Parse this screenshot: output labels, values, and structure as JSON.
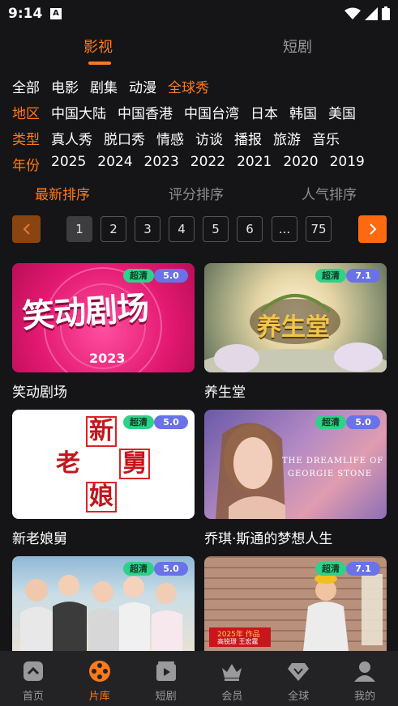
{
  "status": {
    "time": "9:14",
    "notif_glyph": "A"
  },
  "top_tabs": [
    {
      "label": "影视",
      "active": true
    },
    {
      "label": "短剧",
      "active": false
    }
  ],
  "filters": {
    "category": {
      "options": [
        "全部",
        "电影",
        "剧集",
        "动漫",
        "全球秀"
      ],
      "selected": "全球秀"
    },
    "region": {
      "label": "地区",
      "options": [
        "中国大陆",
        "中国香港",
        "中国台湾",
        "日本",
        "韩国",
        "美国"
      ]
    },
    "type": {
      "label": "类型",
      "options": [
        "真人秀",
        "脱口秀",
        "情感",
        "访谈",
        "播报",
        "旅游",
        "音乐"
      ]
    },
    "year": {
      "label": "年份",
      "options": [
        "2025",
        "2024",
        "2023",
        "2022",
        "2021",
        "2020",
        "2019"
      ]
    }
  },
  "sort": [
    {
      "label": "最新排序",
      "active": true
    },
    {
      "label": "评分排序",
      "active": false
    },
    {
      "label": "人气排序",
      "active": false
    }
  ],
  "pager": {
    "pages": [
      "1",
      "2",
      "3",
      "4",
      "5",
      "6",
      "...",
      "75"
    ],
    "current": "1"
  },
  "cards": [
    {
      "title": "笑动剧场",
      "quality": "超清",
      "score": "5.0",
      "art_text": "笑动剧场",
      "art_year": "2023"
    },
    {
      "title": "养生堂",
      "quality": "超清",
      "score": "7.1",
      "art_text": "养生堂"
    },
    {
      "title": "新老娘舅",
      "quality": "超清",
      "score": "5.0",
      "art_chars": [
        "新",
        "老",
        "舅",
        "娘"
      ]
    },
    {
      "title": "乔琪·斯通的梦想人生",
      "quality": "超清",
      "score": "5.0",
      "art_text_1": "THE DREAMLIFE OF",
      "art_text_2": "GEORGIE STONE"
    },
    {
      "title": "",
      "quality": "超清",
      "score": "5.0"
    },
    {
      "title": "",
      "quality": "超清",
      "score": "7.1",
      "art_stamp": "2025年 作品",
      "art_sub": "高锐璟 王宏霆"
    }
  ],
  "bottom_nav": [
    {
      "label": "首页",
      "icon": "home-icon",
      "active": false
    },
    {
      "label": "片库",
      "icon": "film-reel-icon",
      "active": true
    },
    {
      "label": "短剧",
      "icon": "play-clapper-icon",
      "active": false
    },
    {
      "label": "会员",
      "icon": "crown-icon",
      "active": false
    },
    {
      "label": "全球",
      "icon": "diamond-icon",
      "active": false
    },
    {
      "label": "我的",
      "icon": "user-icon",
      "active": false
    }
  ],
  "colors": {
    "accent": "#ff7a1a",
    "background": "#151517",
    "hd_badge": "#2fd18a",
    "score_badge": "#6a72e8"
  }
}
